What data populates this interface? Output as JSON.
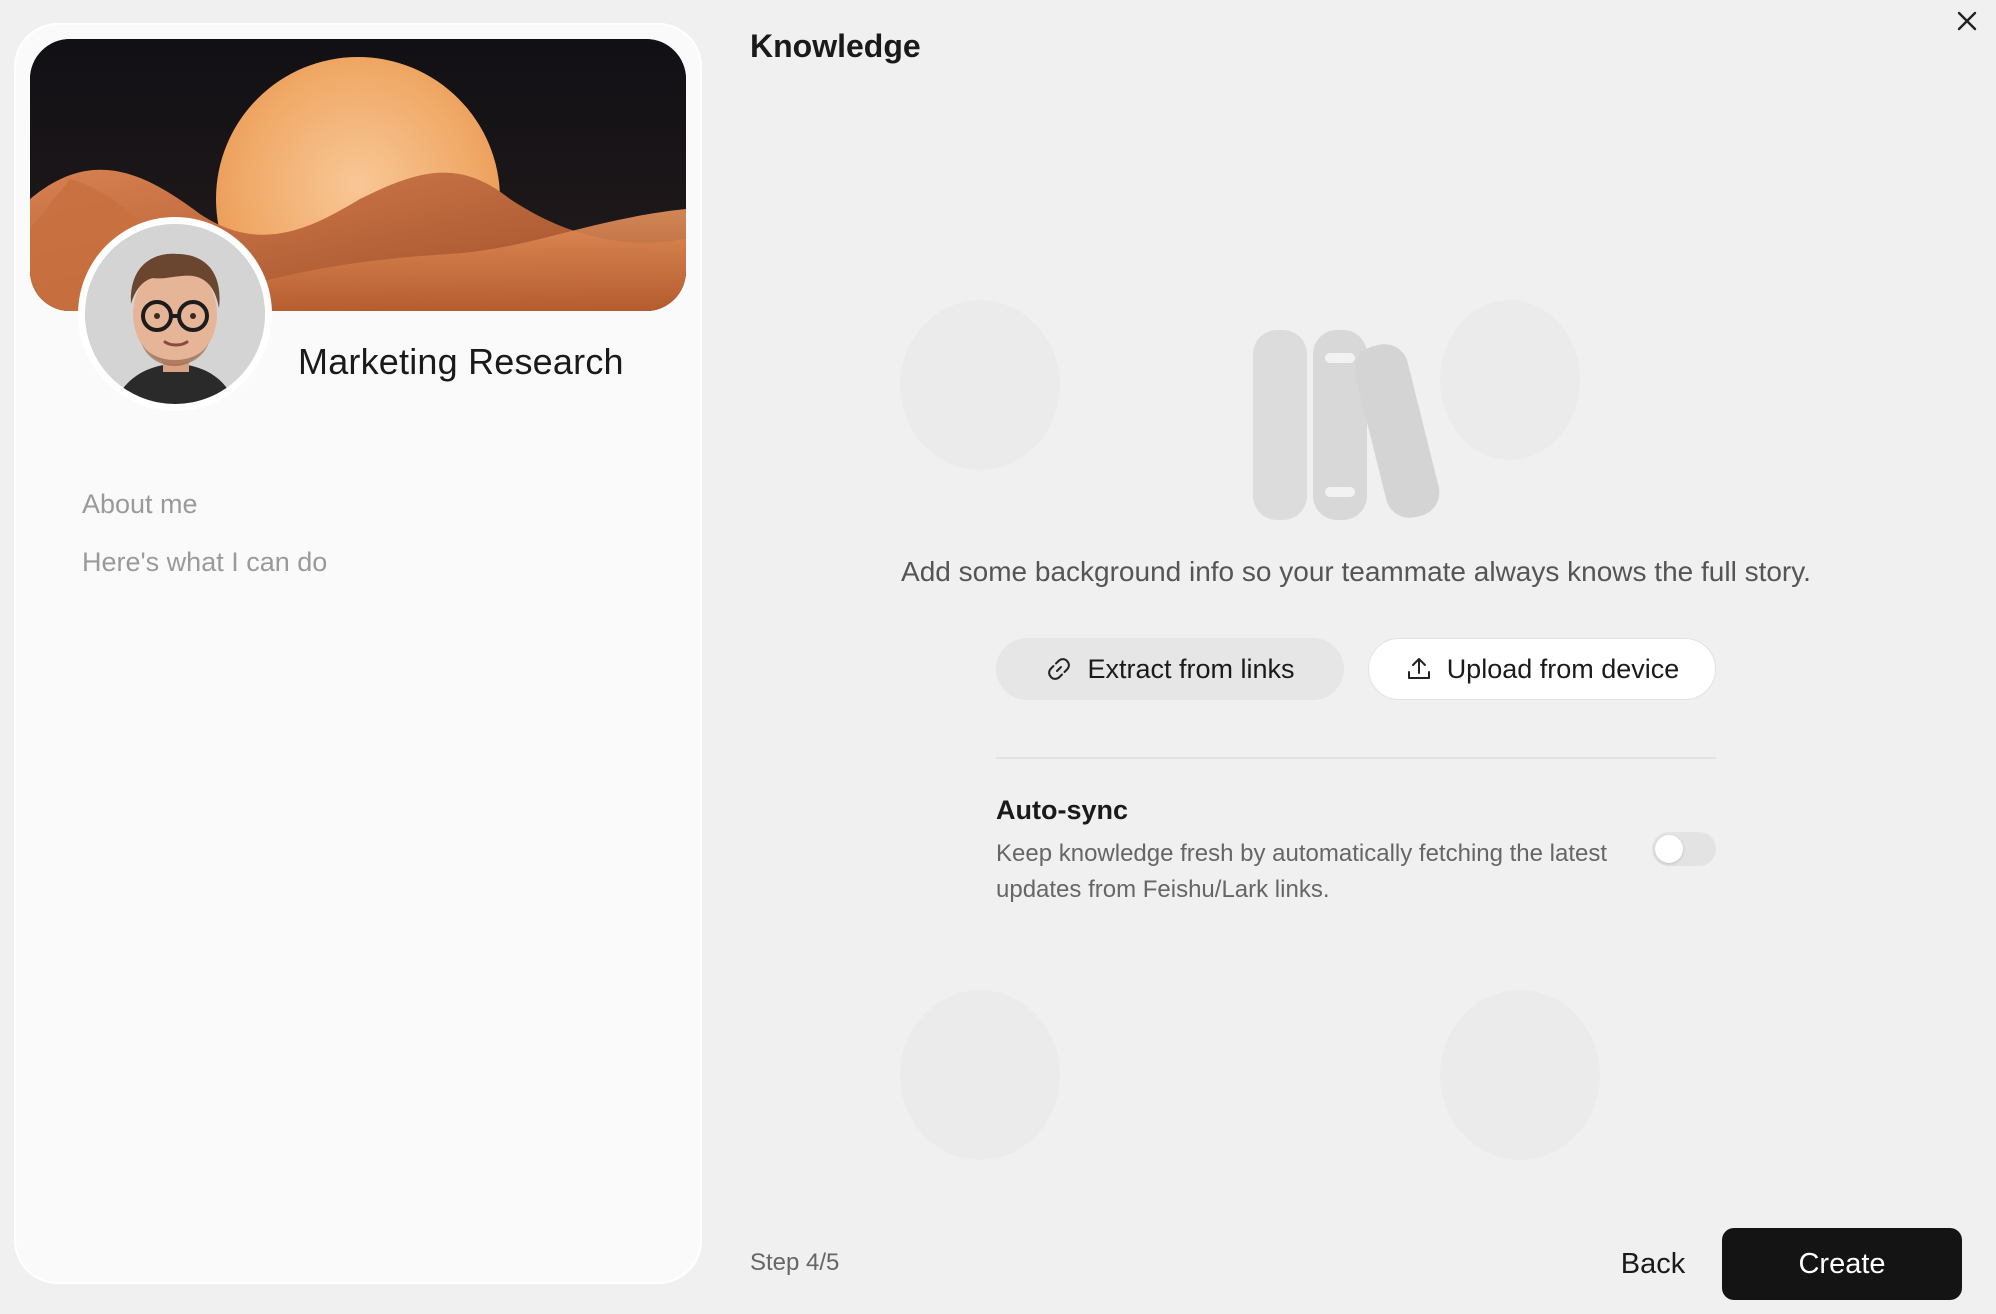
{
  "profile": {
    "name": "Marketing Research",
    "links": [
      "About me",
      "Here's what I can do"
    ]
  },
  "header": {
    "title": "Knowledge",
    "close_icon": "close-icon"
  },
  "knowledge": {
    "intro": "Add some background info so your teammate always knows the full story.",
    "extract_label": "Extract from links",
    "upload_label": "Upload from device"
  },
  "autosync": {
    "title": "Auto-sync",
    "description": "Keep knowledge fresh by automatically fetching the latest updates from Feishu/Lark links.",
    "enabled": false
  },
  "footer": {
    "step": "Step 4/5",
    "back_label": "Back",
    "create_label": "Create"
  },
  "colors": {
    "primary_button": "#141414",
    "background": "#f0f0f0",
    "card": "#fafafa"
  }
}
